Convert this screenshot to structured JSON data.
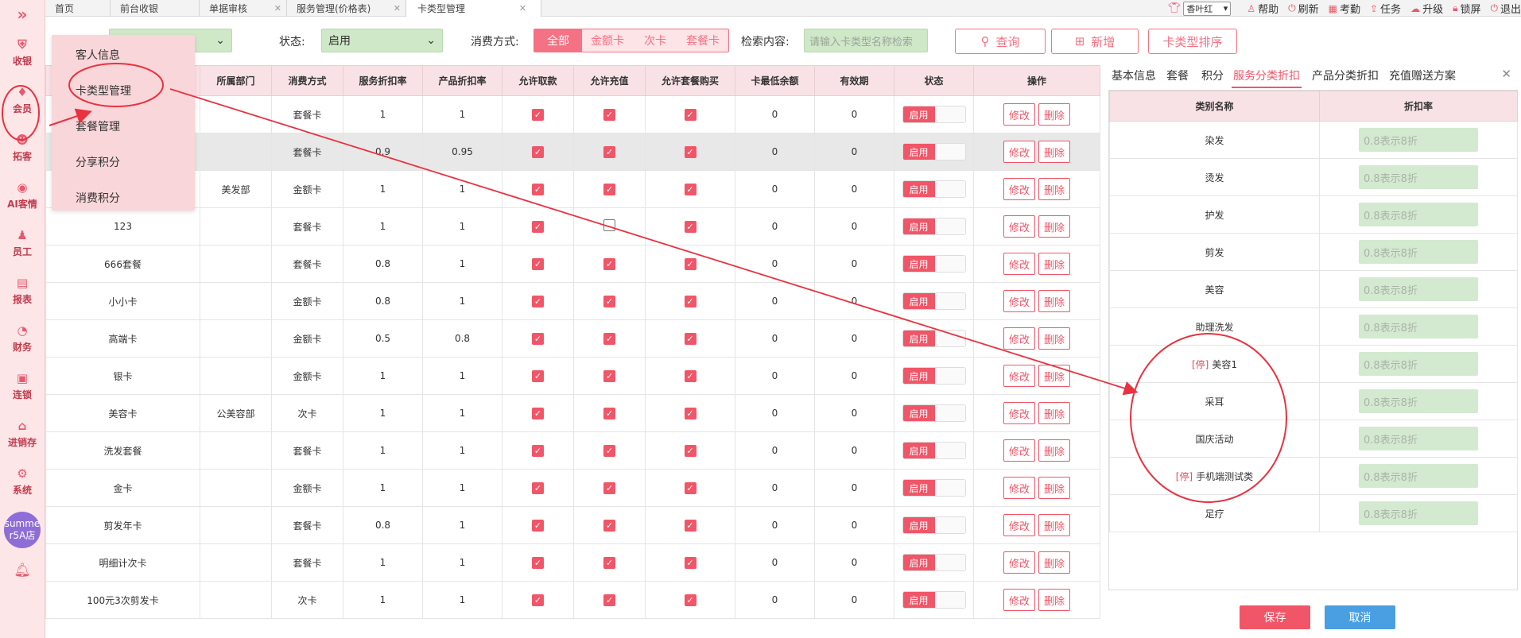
{
  "sidebar": {
    "items": [
      {
        "label": "收银",
        "icon": "shield-icon"
      },
      {
        "label": "会员",
        "icon": "diamond-icon"
      },
      {
        "label": "拓客",
        "icon": "people-icon"
      },
      {
        "label": "AI客情",
        "icon": "ai-icon"
      },
      {
        "label": "员工",
        "icon": "person-icon"
      },
      {
        "label": "报表",
        "icon": "report-icon"
      },
      {
        "label": "财务",
        "icon": "pie-icon"
      },
      {
        "label": "连锁",
        "icon": "chain-icon"
      },
      {
        "label": "进销存",
        "icon": "store-icon"
      },
      {
        "label": "系统",
        "icon": "gear-icon"
      }
    ],
    "store": "summer5A店"
  },
  "topbar": {
    "tabs": [
      "首页",
      "前台收银",
      "单据审核",
      "服务管理(价格表)",
      "卡类型管理"
    ],
    "theme": "香叶红",
    "actions": [
      "帮助",
      "刷新",
      "考勤",
      "任务",
      "升级",
      "锁屏",
      "退出"
    ]
  },
  "filter": {
    "status_label": "状态:",
    "status_value": "启用",
    "consume_label": "消费方式:",
    "consume_options": [
      "全部",
      "金额卡",
      "次卡",
      "套餐卡"
    ],
    "search_label": "检索内容:",
    "search_placeholder": "请输入卡类型名称检索",
    "query_btn": "查询",
    "add_btn": "新增",
    "sort_btn": "卡类型排序"
  },
  "menu": {
    "items": [
      "客人信息",
      "卡类型管理",
      "套餐管理",
      "分享积分",
      "消费积分"
    ]
  },
  "table": {
    "headers": [
      "",
      "所属部门",
      "消费方式",
      "服务折扣率",
      "产品折扣率",
      "允许取款",
      "允许充值",
      "允许套餐购买",
      "卡最低余额",
      "有效期",
      "状态",
      "操作"
    ],
    "status_on": "启用",
    "edit_label": "修改",
    "delete_label": "删除",
    "rows": [
      {
        "name": "",
        "dept": "",
        "type": "套餐卡",
        "svc": "1",
        "prod": "1",
        "withdraw": true,
        "recharge": true,
        "pkg": true,
        "min": "0",
        "valid": "0"
      },
      {
        "name": "",
        "dept": "",
        "type": "套餐卡",
        "svc": "0.9",
        "prod": "0.95",
        "withdraw": true,
        "recharge": true,
        "pkg": true,
        "min": "0",
        "valid": "0"
      },
      {
        "name": "",
        "dept": "美发部",
        "type": "金额卡",
        "svc": "1",
        "prod": "1",
        "withdraw": true,
        "recharge": true,
        "pkg": true,
        "min": "0",
        "valid": "0"
      },
      {
        "name": "123",
        "dept": "",
        "type": "套餐卡",
        "svc": "1",
        "prod": "1",
        "withdraw": true,
        "recharge": false,
        "pkg": true,
        "min": "0",
        "valid": "0"
      },
      {
        "name": "666套餐",
        "dept": "",
        "type": "套餐卡",
        "svc": "0.8",
        "prod": "1",
        "withdraw": true,
        "recharge": true,
        "pkg": true,
        "min": "0",
        "valid": "0"
      },
      {
        "name": "小小卡",
        "dept": "",
        "type": "金额卡",
        "svc": "0.8",
        "prod": "1",
        "withdraw": true,
        "recharge": true,
        "pkg": true,
        "min": "0",
        "valid": "0"
      },
      {
        "name": "高端卡",
        "dept": "",
        "type": "金额卡",
        "svc": "0.5",
        "prod": "0.8",
        "withdraw": true,
        "recharge": true,
        "pkg": true,
        "min": "0",
        "valid": "0"
      },
      {
        "name": "银卡",
        "dept": "",
        "type": "金额卡",
        "svc": "1",
        "prod": "1",
        "withdraw": true,
        "recharge": true,
        "pkg": true,
        "min": "0",
        "valid": "0"
      },
      {
        "name": "美容卡",
        "dept": "公美容部",
        "type": "次卡",
        "svc": "1",
        "prod": "1",
        "withdraw": true,
        "recharge": true,
        "pkg": true,
        "min": "0",
        "valid": "0"
      },
      {
        "name": "洗发套餐",
        "dept": "",
        "type": "套餐卡",
        "svc": "1",
        "prod": "1",
        "withdraw": true,
        "recharge": true,
        "pkg": true,
        "min": "0",
        "valid": "0"
      },
      {
        "name": "金卡",
        "dept": "",
        "type": "金额卡",
        "svc": "1",
        "prod": "1",
        "withdraw": true,
        "recharge": true,
        "pkg": true,
        "min": "0",
        "valid": "0"
      },
      {
        "name": "剪发年卡",
        "dept": "",
        "type": "套餐卡",
        "svc": "0.8",
        "prod": "1",
        "withdraw": true,
        "recharge": true,
        "pkg": true,
        "min": "0",
        "valid": "0"
      },
      {
        "name": "明细计次卡",
        "dept": "",
        "type": "套餐卡",
        "svc": "1",
        "prod": "1",
        "withdraw": true,
        "recharge": true,
        "pkg": true,
        "min": "0",
        "valid": "0"
      },
      {
        "name": "100元3次剪发卡",
        "dept": "",
        "type": "次卡",
        "svc": "1",
        "prod": "1",
        "withdraw": true,
        "recharge": true,
        "pkg": true,
        "min": "0",
        "valid": "0"
      }
    ]
  },
  "panel": {
    "tabs": [
      "基本信息",
      "套餐",
      "积分",
      "服务分类折扣",
      "产品分类折扣",
      "充值赠送方案"
    ],
    "active_tab": 3,
    "headers": [
      "类别名称",
      "折扣率"
    ],
    "rate_placeholder": "0.8表示8折",
    "stop_tag": "[停]",
    "rows": [
      {
        "name": "染发",
        "stopped": false
      },
      {
        "name": "烫发",
        "stopped": false
      },
      {
        "name": "护发",
        "stopped": false
      },
      {
        "name": "剪发",
        "stopped": false
      },
      {
        "name": "美容",
        "stopped": false
      },
      {
        "name": "助理洗发",
        "stopped": false
      },
      {
        "name": "美容1",
        "stopped": true
      },
      {
        "name": "采耳",
        "stopped": false
      },
      {
        "name": "国庆活动",
        "stopped": false
      },
      {
        "name": "手机端测试类",
        "stopped": true
      },
      {
        "name": "足疗",
        "stopped": false
      }
    ],
    "save": "保存",
    "cancel": "取消"
  },
  "colors": {
    "accent": "#f15668",
    "input_green": "#cfe8c8",
    "menu_bg": "#f9d6d9",
    "annotation": "#e8323f"
  }
}
